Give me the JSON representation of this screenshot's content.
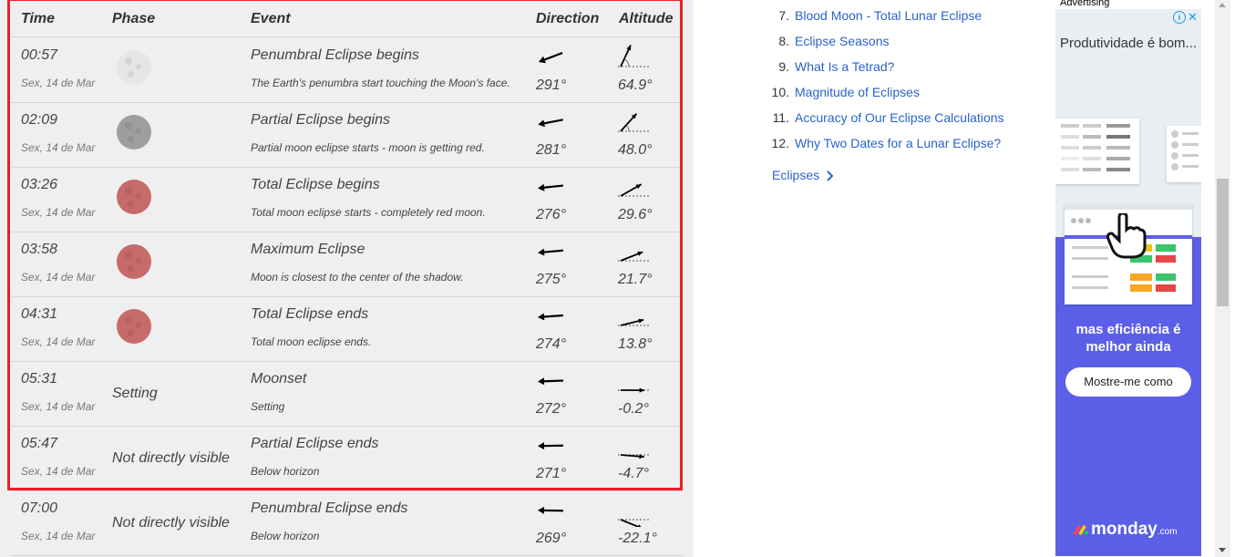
{
  "table": {
    "headers": {
      "time": "Time",
      "phase": "Phase",
      "event": "Event",
      "direction": "Direction",
      "altitude": "Altitude"
    },
    "rows": [
      {
        "time": "00:57",
        "date": "Sex, 14 de Mar",
        "moon": "penumbral-moon-icon",
        "moon_color": "#e6e6e6",
        "phase_text": "",
        "event": "Penumbral Eclipse begins",
        "desc": "The Earth's penumbra start touching the Moon's face.",
        "direction": "291°",
        "altitude": "64.9°"
      },
      {
        "time": "02:09",
        "date": "Sex, 14 de Mar",
        "moon": "partial-moon-icon",
        "moon_color": "#9e9e9e",
        "phase_text": "",
        "event": "Partial Eclipse begins",
        "desc": "Partial moon eclipse starts - moon is getting red.",
        "direction": "281°",
        "altitude": "48.0°"
      },
      {
        "time": "03:26",
        "date": "Sex, 14 de Mar",
        "moon": "red-moon-icon",
        "moon_color": "#c76a6a",
        "phase_text": "",
        "event": "Total Eclipse begins",
        "desc": "Total moon eclipse starts - completely red moon.",
        "direction": "276°",
        "altitude": "29.6°"
      },
      {
        "time": "03:58",
        "date": "Sex, 14 de Mar",
        "moon": "red-moon-icon",
        "moon_color": "#c76a6a",
        "phase_text": "",
        "event": "Maximum Eclipse",
        "desc": "Moon is closest to the center of the shadow.",
        "direction": "275°",
        "altitude": "21.7°"
      },
      {
        "time": "04:31",
        "date": "Sex, 14 de Mar",
        "moon": "red-moon-icon",
        "moon_color": "#c76a6a",
        "phase_text": "",
        "event": "Total Eclipse ends",
        "desc": "Total moon eclipse ends.",
        "direction": "274°",
        "altitude": "13.8°"
      },
      {
        "time": "05:31",
        "date": "Sex, 14 de Mar",
        "moon": "",
        "moon_color": "",
        "phase_text": "Setting",
        "event": "Moonset",
        "desc": "Setting",
        "direction": "272°",
        "altitude": "-0.2°"
      },
      {
        "time": "05:47",
        "date": "Sex, 14 de Mar",
        "moon": "",
        "moon_color": "",
        "phase_text": "Not directly visible",
        "event": "Partial Eclipse ends",
        "desc": "Below horizon",
        "direction": "271°",
        "altitude": "-4.7°"
      },
      {
        "time": "07:00",
        "date": "Sex, 14 de Mar",
        "moon": "",
        "moon_color": "",
        "phase_text": "Not directly visible",
        "event": "Penumbral Eclipse ends",
        "desc": "Below horizon",
        "direction": "269°",
        "altitude": "-22.1°"
      }
    ]
  },
  "toc": {
    "items": [
      {
        "num": "7.",
        "label": "Blood Moon - Total Lunar Eclipse"
      },
      {
        "num": "8.",
        "label": "Eclipse Seasons"
      },
      {
        "num": "9.",
        "label": "What Is a Tetrad?"
      },
      {
        "num": "10.",
        "label": "Magnitude of Eclipses"
      },
      {
        "num": "11.",
        "label": "Accuracy of Our Eclipse Calculations"
      },
      {
        "num": "12.",
        "label": "Why Two Dates for a Lunar Eclipse?"
      }
    ],
    "eclipses_link": "Eclipses"
  },
  "ad": {
    "label": "Advertising",
    "headline": "Produtividade é bom...",
    "subline": "mas eficiência é melhor ainda",
    "button": "Mostre-me como",
    "brand": "monday",
    "brand_suffix": ".com",
    "info_glyph": "i",
    "close_glyph": "✕",
    "colors": {
      "top": "#e9eef2",
      "bottom": "#5b5fe8"
    }
  },
  "colors": {
    "accent_link": "#2a63c7",
    "highlight_border": "#e8202a"
  }
}
